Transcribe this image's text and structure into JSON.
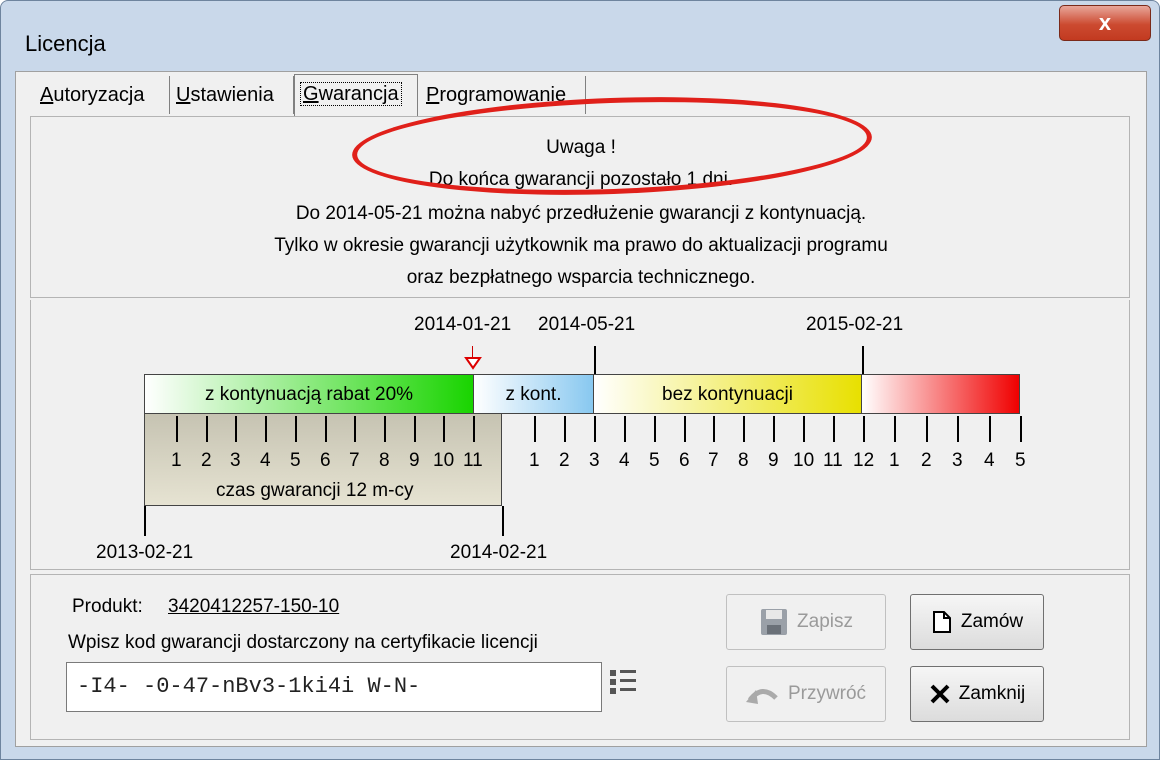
{
  "window": {
    "title": "Licencja",
    "close_symbol": "x"
  },
  "tabs": [
    {
      "label": "Autoryzacja",
      "accel": "A",
      "rest": "utoryzacja"
    },
    {
      "label": "Ustawienia",
      "accel": "U",
      "rest": "stawienia"
    },
    {
      "label": "Gwarancja",
      "accel": "G",
      "rest": "warancja",
      "active": true
    },
    {
      "label": "Programowanie",
      "accel": "P",
      "rest": "rogramowanie"
    }
  ],
  "message": {
    "line1": "Uwaga !",
    "line2": "Do końca gwarancji pozostało 1 dni.",
    "line3": "Do 2014-05-21 można nabyć przedłużenie gwarancji z kontynuacją.",
    "line4": "Tylko w okresie gwarancji użytkownik ma prawo do aktualizacji programu",
    "line5": "oraz bezpłatnego wsparcia technicznego."
  },
  "timeline": {
    "top_dates": [
      "2014-01-21",
      "2014-05-21",
      "2015-02-21"
    ],
    "bottom_dates": [
      "2013-02-21",
      "2014-02-21"
    ],
    "segments": [
      {
        "label": "z kontynuacją rabat 20%",
        "color": "#19d400"
      },
      {
        "label": "z kont.",
        "color": "#88c8f0"
      },
      {
        "label": "bez kontynuacji",
        "color": "#e8e000"
      },
      {
        "label": "",
        "color": "#f00000"
      }
    ],
    "month_ticks_a": [
      "1",
      "2",
      "3",
      "4",
      "5",
      "6",
      "7",
      "8",
      "9",
      "10",
      "11"
    ],
    "month_ticks_b": [
      "1",
      "2",
      "3",
      "4",
      "5",
      "6",
      "7",
      "8",
      "9",
      "10",
      "11",
      "12"
    ],
    "month_ticks_c": [
      "1",
      "2",
      "3",
      "4",
      "5"
    ],
    "warranty_label": "czas gwarancji 12 m-cy"
  },
  "product": {
    "label": "Produkt:",
    "value": "3420412257-150-10"
  },
  "code": {
    "label": "Wpisz kod gwarancji dostarczony  na certyfikacie licencji",
    "value": "-I4-  -0-47-nBv3-1ki4i  W-N-"
  },
  "buttons": {
    "save": "Zapisz",
    "order": "Zamów",
    "restore": "Przywróć",
    "close": "Zamknij"
  }
}
